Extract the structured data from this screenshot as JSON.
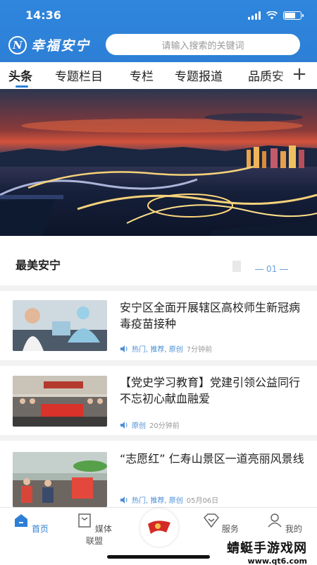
{
  "status_bar": {
    "time": "14:36"
  },
  "header": {
    "app_name": "幸福安宁",
    "search_placeholder": "请输入搜索的关键词"
  },
  "tabs": [
    {
      "label": "头条",
      "active": true
    },
    {
      "label": "专题栏目"
    },
    {
      "label": "专栏"
    },
    {
      "label": "专题报道"
    },
    {
      "label": "品质安"
    }
  ],
  "section": {
    "title": "最美安宁",
    "page_indicator": "01"
  },
  "news": [
    {
      "title": "安宁区全面开展辖区高校师生新冠病毒疫苗接种",
      "tags": "热门, 推荐, 原创",
      "time": "7分钟前"
    },
    {
      "title": "【党史学习教育】党建引领公益同行 不忘初心献血融爱",
      "tags": "原创",
      "time": "20分钟前"
    },
    {
      "title": "“志愿红” 仁寿山景区一道亮丽风景线",
      "tags": "热门, 推荐, 原创",
      "time": "05月06日"
    }
  ],
  "bottom_nav": [
    {
      "label": "首页",
      "icon": "home-icon",
      "active": true
    },
    {
      "label": "媒体联盟",
      "icon": "media-icon"
    },
    {
      "label": "服务",
      "icon": "service-icon"
    },
    {
      "label": "我的",
      "icon": "profile-icon"
    }
  ],
  "watermark": {
    "line1": "蜻蜓手游戏网",
    "line2": "www.qt6.com"
  },
  "colors": {
    "brand_blue": "#2d7fd6",
    "tag_blue": "#4b8fd6"
  }
}
